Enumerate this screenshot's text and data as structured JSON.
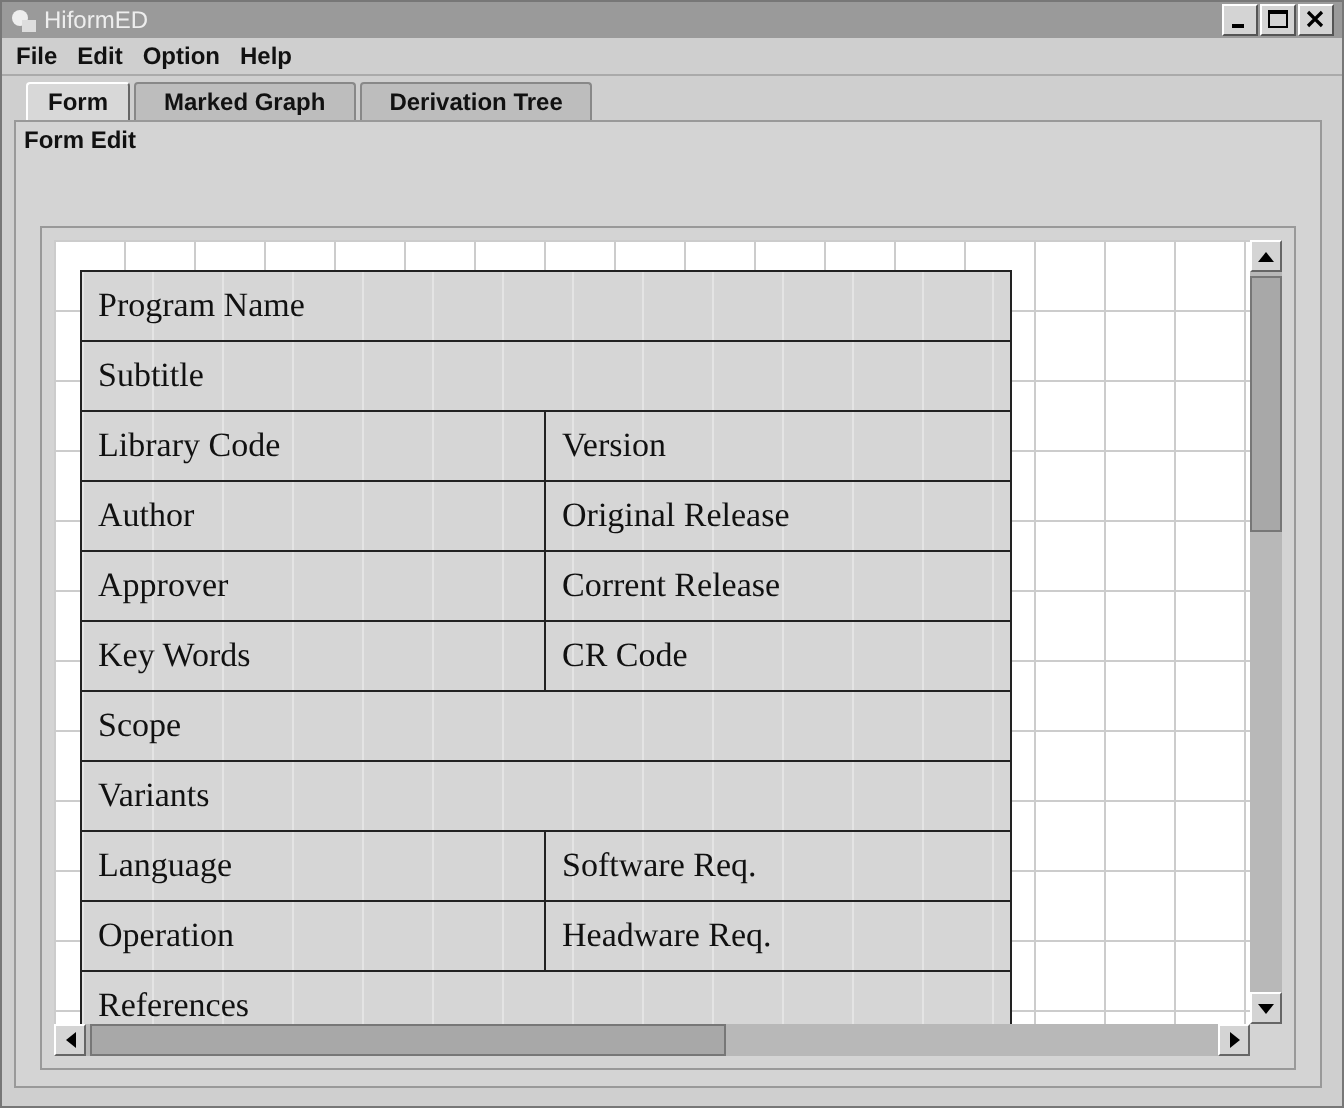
{
  "window": {
    "title": "HiformED"
  },
  "menu": [
    "File",
    "Edit",
    "Option",
    "Help"
  ],
  "tabs": [
    {
      "label": "Form",
      "selected": true
    },
    {
      "label": "Marked Graph",
      "selected": false
    },
    {
      "label": "Derivation Tree",
      "selected": false
    }
  ],
  "panel": {
    "title": "Form Edit"
  },
  "form_rows": [
    {
      "cells": [
        "Program Name"
      ]
    },
    {
      "cells": [
        "Subtitle"
      ]
    },
    {
      "cells": [
        "Library Code",
        "Version"
      ]
    },
    {
      "cells": [
        "Author",
        "Original Release"
      ]
    },
    {
      "cells": [
        "Approver",
        "Corrent Release"
      ]
    },
    {
      "cells": [
        "Key Words",
        "CR Code"
      ]
    },
    {
      "cells": [
        "Scope"
      ]
    },
    {
      "cells": [
        "Variants"
      ]
    },
    {
      "cells": [
        "Language",
        "Software Req."
      ]
    },
    {
      "cells": [
        "Operation",
        "Headware Req."
      ]
    },
    {
      "cells": [
        "References"
      ]
    }
  ]
}
